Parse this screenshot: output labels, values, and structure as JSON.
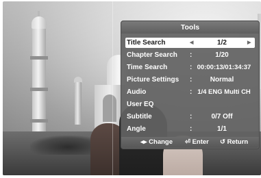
{
  "menu": {
    "title": "Tools",
    "items": [
      {
        "label": "Title Search",
        "separator": "",
        "value": "1/2",
        "selected": true
      },
      {
        "label": "Chapter Search",
        "separator": ":",
        "value": "1/20"
      },
      {
        "label": "Time Search",
        "separator": ":",
        "value": "00:00:13/01:34:37"
      },
      {
        "label": "Picture Settings",
        "separator": ":",
        "value": "Normal"
      },
      {
        "label": "Audio",
        "separator": ":",
        "value": "1/4 ENG Multi CH"
      },
      {
        "label": "User EQ",
        "separator": "",
        "value": ""
      },
      {
        "label": "Subtitle",
        "separator": ":",
        "value": "0/7 Off"
      },
      {
        "label": "Angle",
        "separator": ":",
        "value": "1/1"
      }
    ],
    "arrows": {
      "left": "◀",
      "right": "▶"
    },
    "footer": {
      "change": "◂▸ Change",
      "enter": "⏎ Enter",
      "return": "↺ Return"
    }
  },
  "icons": [
    "left-arrow-icon",
    "right-arrow-icon",
    "change-icon",
    "enter-icon",
    "return-icon"
  ],
  "colors": {
    "menu_bg": "#626262",
    "selected_bg": "#ffffff",
    "text": "#ffffff"
  }
}
